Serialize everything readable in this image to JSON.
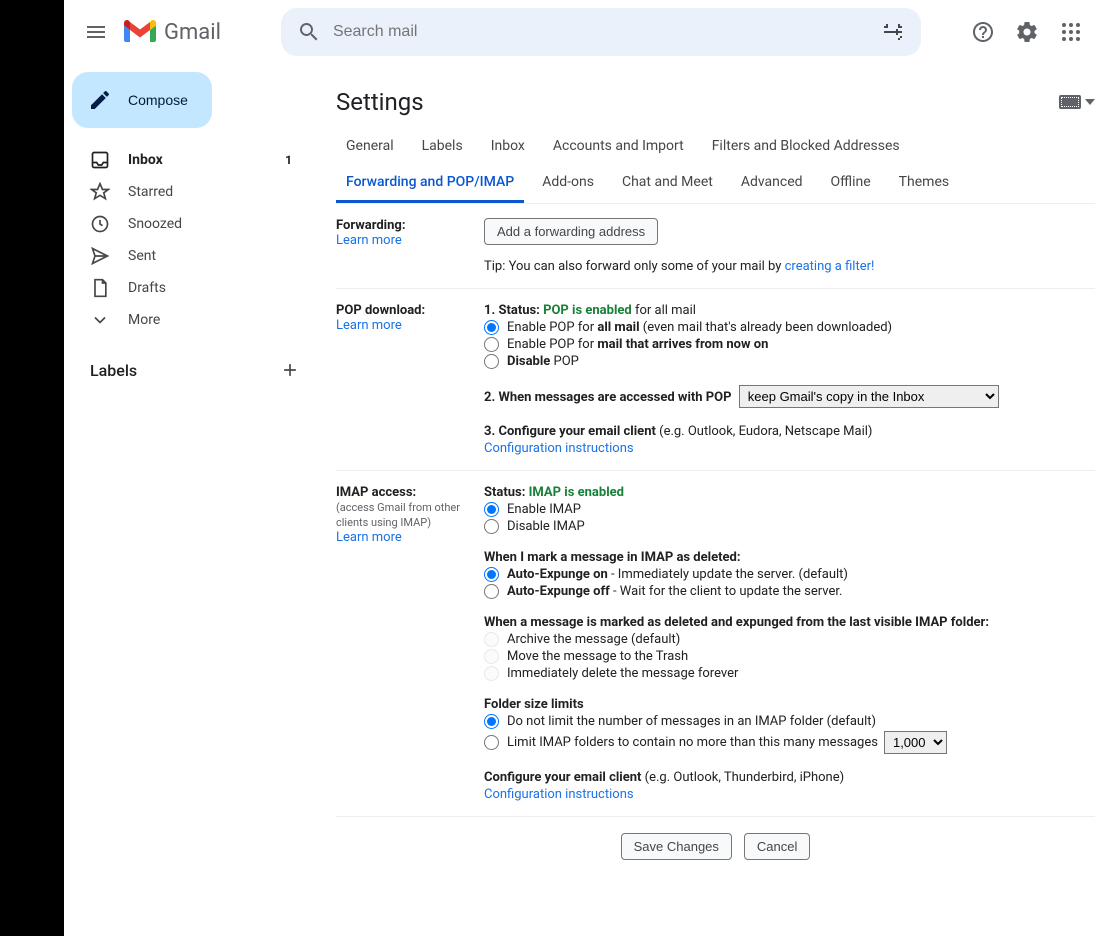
{
  "header": {
    "logo_text": "Gmail",
    "search_placeholder": "Search mail"
  },
  "compose_label": "Compose",
  "nav": [
    {
      "label": "Inbox",
      "count": "1"
    },
    {
      "label": "Starred",
      "count": ""
    },
    {
      "label": "Snoozed",
      "count": ""
    },
    {
      "label": "Sent",
      "count": ""
    },
    {
      "label": "Drafts",
      "count": ""
    },
    {
      "label": "More",
      "count": ""
    }
  ],
  "labels_header": "Labels",
  "settings_title": "Settings",
  "tabs": [
    "General",
    "Labels",
    "Inbox",
    "Accounts and Import",
    "Filters and Blocked Addresses",
    "Forwarding and POP/IMAP",
    "Add-ons",
    "Chat and Meet",
    "Advanced",
    "Offline",
    "Themes"
  ],
  "forwarding": {
    "title": "Forwarding:",
    "learn": "Learn more",
    "add_btn": "Add a forwarding address",
    "tip_pre": "Tip: You can also forward only some of your mail by ",
    "tip_link": "creating a filter!"
  },
  "pop": {
    "title": "POP download:",
    "learn": "Learn more",
    "s1_prefix": "1. Status: ",
    "s1_status": "POP is enabled",
    "s1_suffix": " for all mail",
    "r1_pre": "Enable POP for ",
    "r1_bold": "all mail",
    "r1_post": " (even mail that's already been downloaded)",
    "r2_pre": "Enable POP for ",
    "r2_bold": "mail that arrives from now on",
    "r3_bold": "Disable",
    "r3_post": " POP",
    "s2": "2. When messages are accessed with POP",
    "s2_select": "keep Gmail's copy in the Inbox",
    "s3_bold": "3. Configure your email client",
    "s3_post": " (e.g. Outlook, Eudora, Netscape Mail)",
    "config_link": "Configuration instructions"
  },
  "imap": {
    "title": "IMAP access:",
    "sub": "(access Gmail from other clients using IMAP)",
    "learn": "Learn more",
    "status_pre": "Status: ",
    "status": "IMAP is enabled",
    "r1": "Enable IMAP",
    "r2": "Disable IMAP",
    "del_h": "When I mark a message in IMAP as deleted:",
    "del_r1_b": "Auto-Expunge on",
    "del_r1_p": " - Immediately update the server. (default)",
    "del_r2_b": "Auto-Expunge off",
    "del_r2_p": " - Wait for the client to update the server.",
    "exp_h": "When a message is marked as deleted and expunged from the last visible IMAP folder:",
    "exp_r1": "Archive the message (default)",
    "exp_r2": "Move the message to the Trash",
    "exp_r3": "Immediately delete the message forever",
    "fsl_h": "Folder size limits",
    "fsl_r1": "Do not limit the number of messages in an IMAP folder (default)",
    "fsl_r2": "Limit IMAP folders to contain no more than this many messages",
    "fsl_select": "1,000",
    "cfg_b": "Configure your email client",
    "cfg_p": " (e.g. Outlook, Thunderbird, iPhone)",
    "cfg_link": "Configuration instructions"
  },
  "footer": {
    "save": "Save Changes",
    "cancel": "Cancel"
  }
}
